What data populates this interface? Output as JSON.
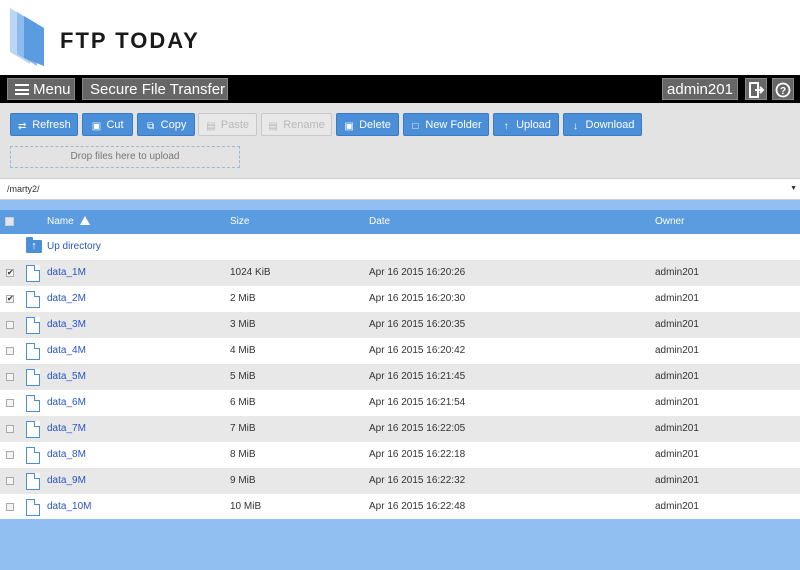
{
  "brand": {
    "name": "FTP TODAY"
  },
  "navbar": {
    "menu_label": "Menu",
    "title": "Secure File Transfer",
    "user": "admin201"
  },
  "toolbar": {
    "buttons": [
      {
        "label": "Refresh",
        "icon": "refresh-icon",
        "disabled": false
      },
      {
        "label": "Cut",
        "icon": "cut-icon",
        "disabled": false
      },
      {
        "label": "Copy",
        "icon": "copy-icon",
        "disabled": false
      },
      {
        "label": "Paste",
        "icon": "paste-icon",
        "disabled": true
      },
      {
        "label": "Rename",
        "icon": "rename-icon",
        "disabled": true
      },
      {
        "label": "Delete",
        "icon": "delete-icon",
        "disabled": false
      },
      {
        "label": "New Folder",
        "icon": "new-folder-icon",
        "disabled": false
      },
      {
        "label": "Upload",
        "icon": "upload-icon",
        "disabled": false
      },
      {
        "label": "Download",
        "icon": "download-icon",
        "disabled": false
      }
    ],
    "dropzone": "Drop files here to upload"
  },
  "path": "/marty2/",
  "table": {
    "headers": {
      "name": "Name",
      "size": "Size",
      "date": "Date",
      "owner": "Owner"
    },
    "up_directory": "Up directory",
    "rows": [
      {
        "name": "data_1M",
        "size": "1024 KiB",
        "date": "Apr 16 2015 16:20:26",
        "owner": "admin201",
        "checked": true
      },
      {
        "name": "data_2M",
        "size": "2 MiB",
        "date": "Apr 16 2015 16:20:30",
        "owner": "admin201",
        "checked": true
      },
      {
        "name": "data_3M",
        "size": "3 MiB",
        "date": "Apr 16 2015 16:20:35",
        "owner": "admin201",
        "checked": false
      },
      {
        "name": "data_4M",
        "size": "4 MiB",
        "date": "Apr 16 2015 16:20:42",
        "owner": "admin201",
        "checked": false
      },
      {
        "name": "data_5M",
        "size": "5 MiB",
        "date": "Apr 16 2015 16:21:45",
        "owner": "admin201",
        "checked": false
      },
      {
        "name": "data_6M",
        "size": "6 MiB",
        "date": "Apr 16 2015 16:21:54",
        "owner": "admin201",
        "checked": false
      },
      {
        "name": "data_7M",
        "size": "7 MiB",
        "date": "Apr 16 2015 16:22:05",
        "owner": "admin201",
        "checked": false
      },
      {
        "name": "data_8M",
        "size": "8 MiB",
        "date": "Apr 16 2015 16:22:18",
        "owner": "admin201",
        "checked": false
      },
      {
        "name": "data_9M",
        "size": "9 MiB",
        "date": "Apr 16 2015 16:22:32",
        "owner": "admin201",
        "checked": false
      },
      {
        "name": "data_10M",
        "size": "10 MiB",
        "date": "Apr 16 2015 16:22:48",
        "owner": "admin201",
        "checked": false
      }
    ]
  },
  "colors": {
    "accent": "#4a8fd8",
    "header": "#5b9be0",
    "band": "#91bff2",
    "link": "#2a54c4"
  }
}
